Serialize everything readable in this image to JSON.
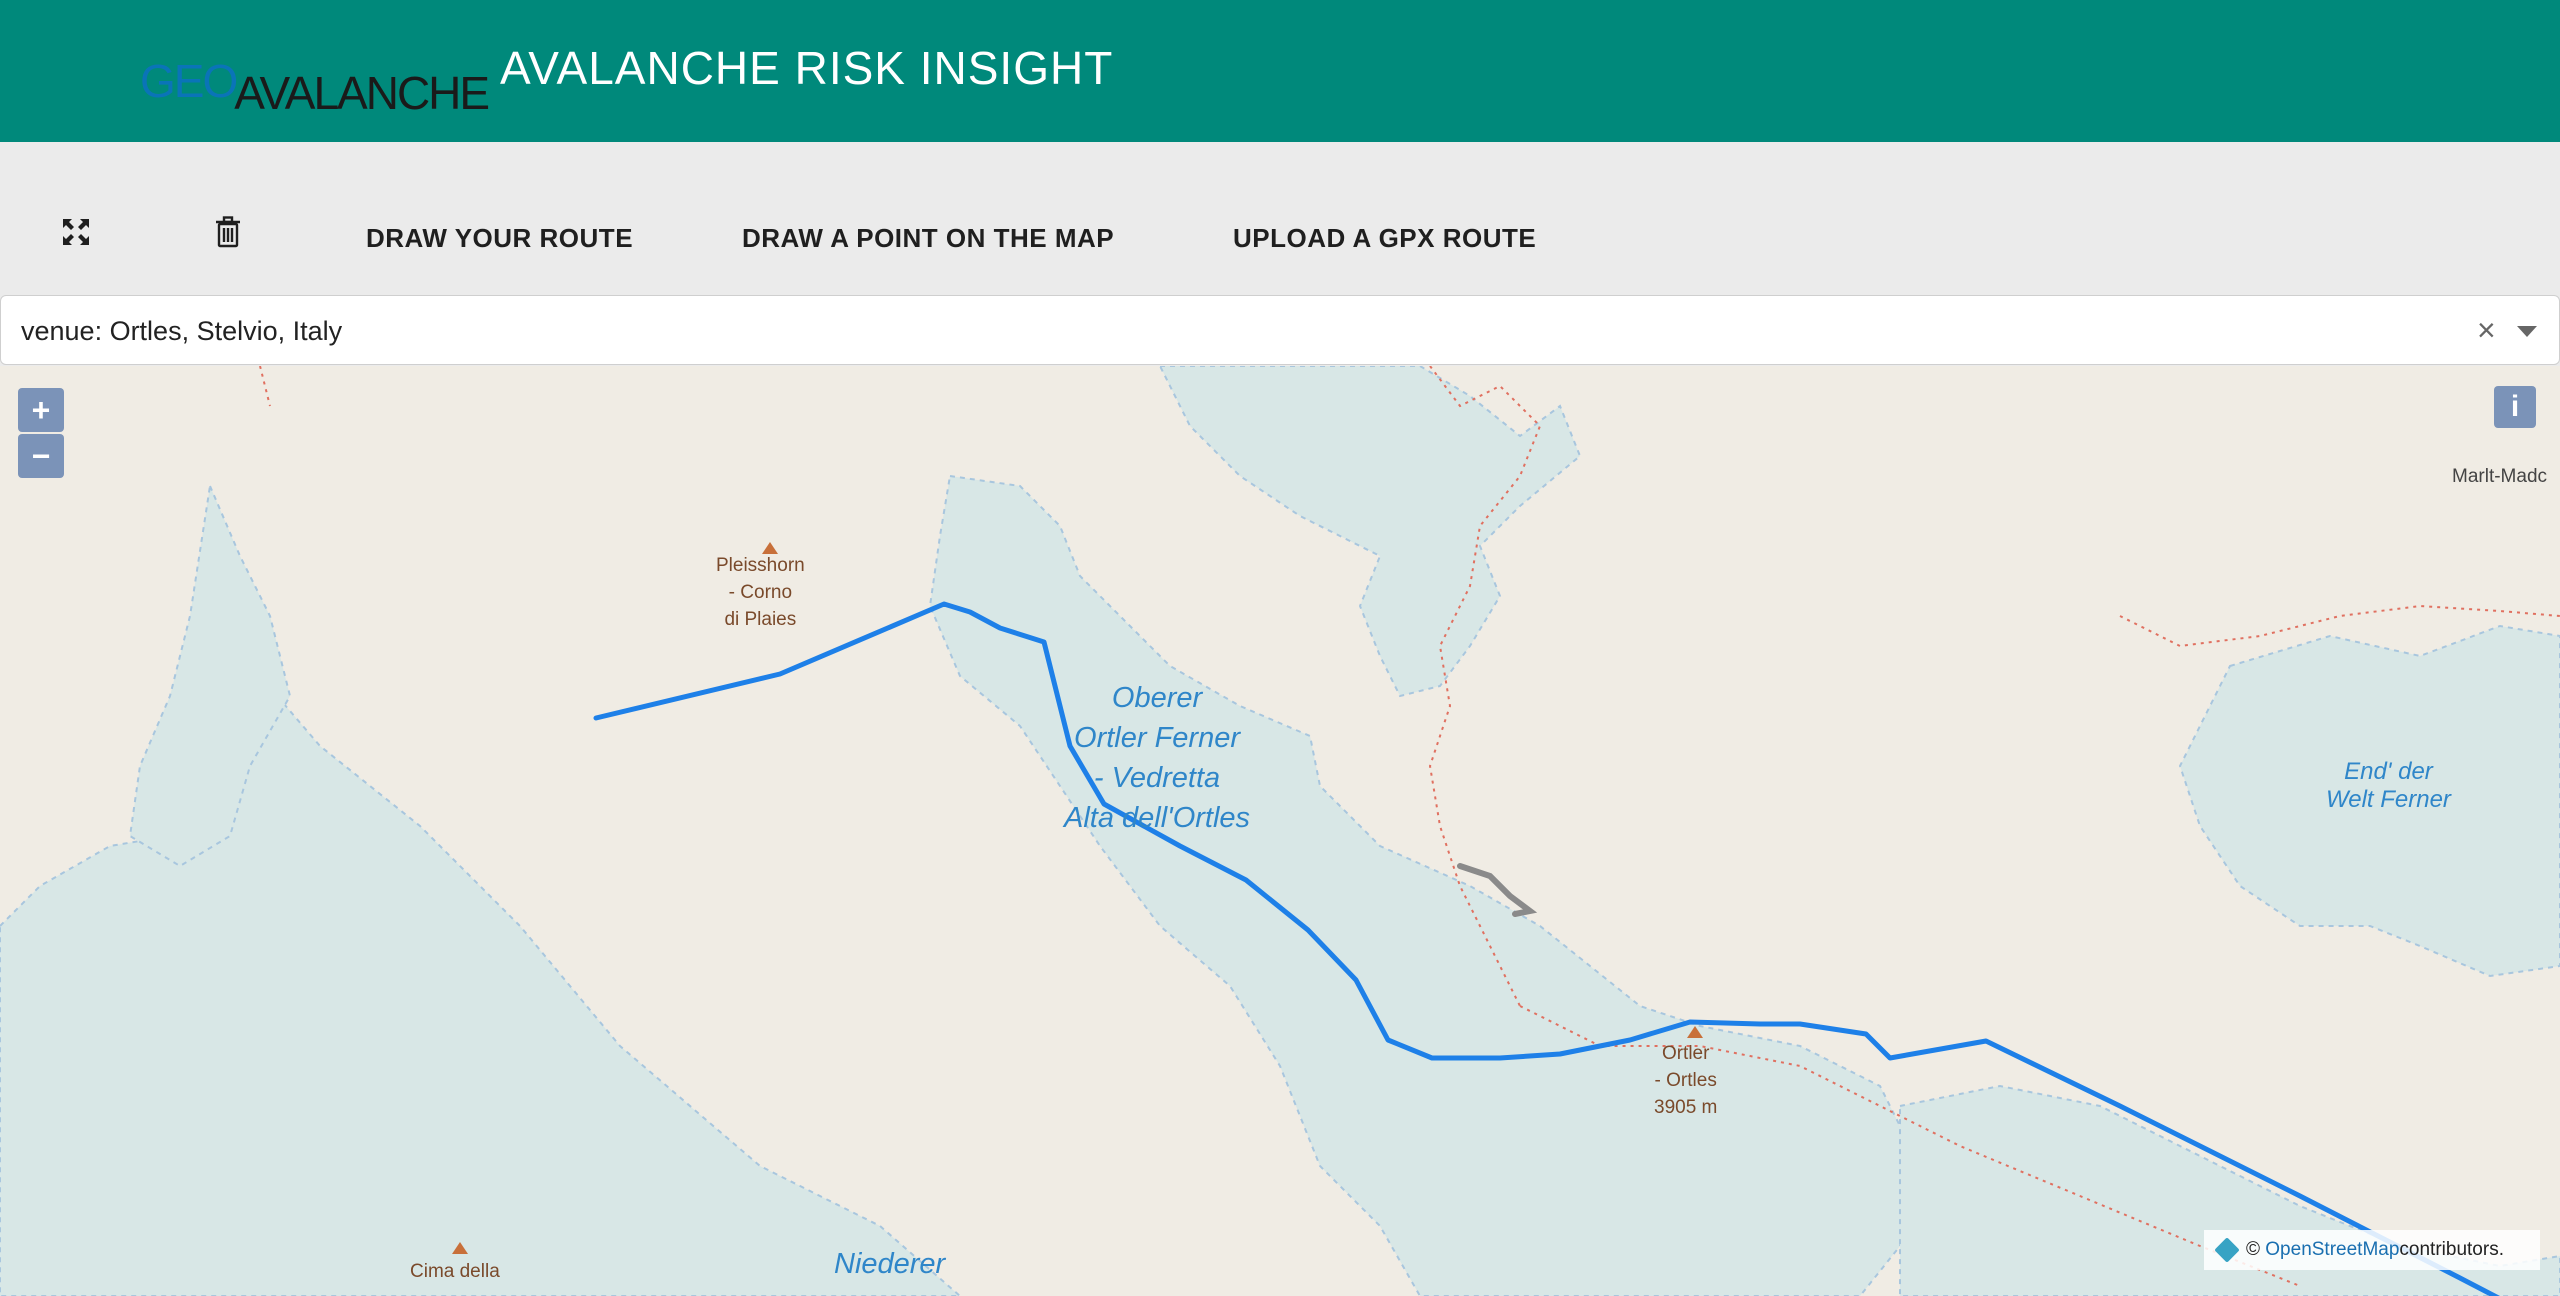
{
  "header": {
    "logo_geo": "GEO",
    "logo_avalanche": "AVALANCHE",
    "title": "AVALANCHE RISK INSIGHT"
  },
  "toolbar": {
    "fullscreen_icon": "expand-icon",
    "delete_icon": "trash-icon",
    "draw_route_label": "DRAW YOUR ROUTE",
    "draw_point_label": "DRAW A POINT ON THE MAP",
    "upload_gpx_label": "UPLOAD A GPX ROUTE"
  },
  "venue": {
    "value": "venue: Ortles, Stelvio, Italy",
    "clear_icon": "close-icon",
    "caret_icon": "chevron-down-icon"
  },
  "map": {
    "zoom_in": "+",
    "zoom_out": "−",
    "info": "i",
    "labels": {
      "pleisshorn_1": "Pleisshorn",
      "pleisshorn_2": "- Corno",
      "pleisshorn_3": "di Plaies",
      "oberer_1": "Oberer",
      "oberer_2": "Ortler Ferner",
      "oberer_3": "- Vedretta",
      "oberer_4": "Alta dell'Ortles",
      "end_der_1": "End' der",
      "end_der_2": "Welt Ferner",
      "ortler_1": "Ortler",
      "ortler_2": "- Ortles",
      "ortler_3": "3905 m",
      "cima": "Cima della",
      "niederer": "Niederer",
      "marlt": "Marlt-Madc"
    },
    "attribution_prefix": "©",
    "attribution_link": "OpenStreetMap",
    "attribution_suffix": " contributors.",
    "colors": {
      "land": "#f0ece4",
      "glacier": "#d8e7e6",
      "route": "#1e80e8",
      "zoom_button": "#7b93b8"
    }
  }
}
